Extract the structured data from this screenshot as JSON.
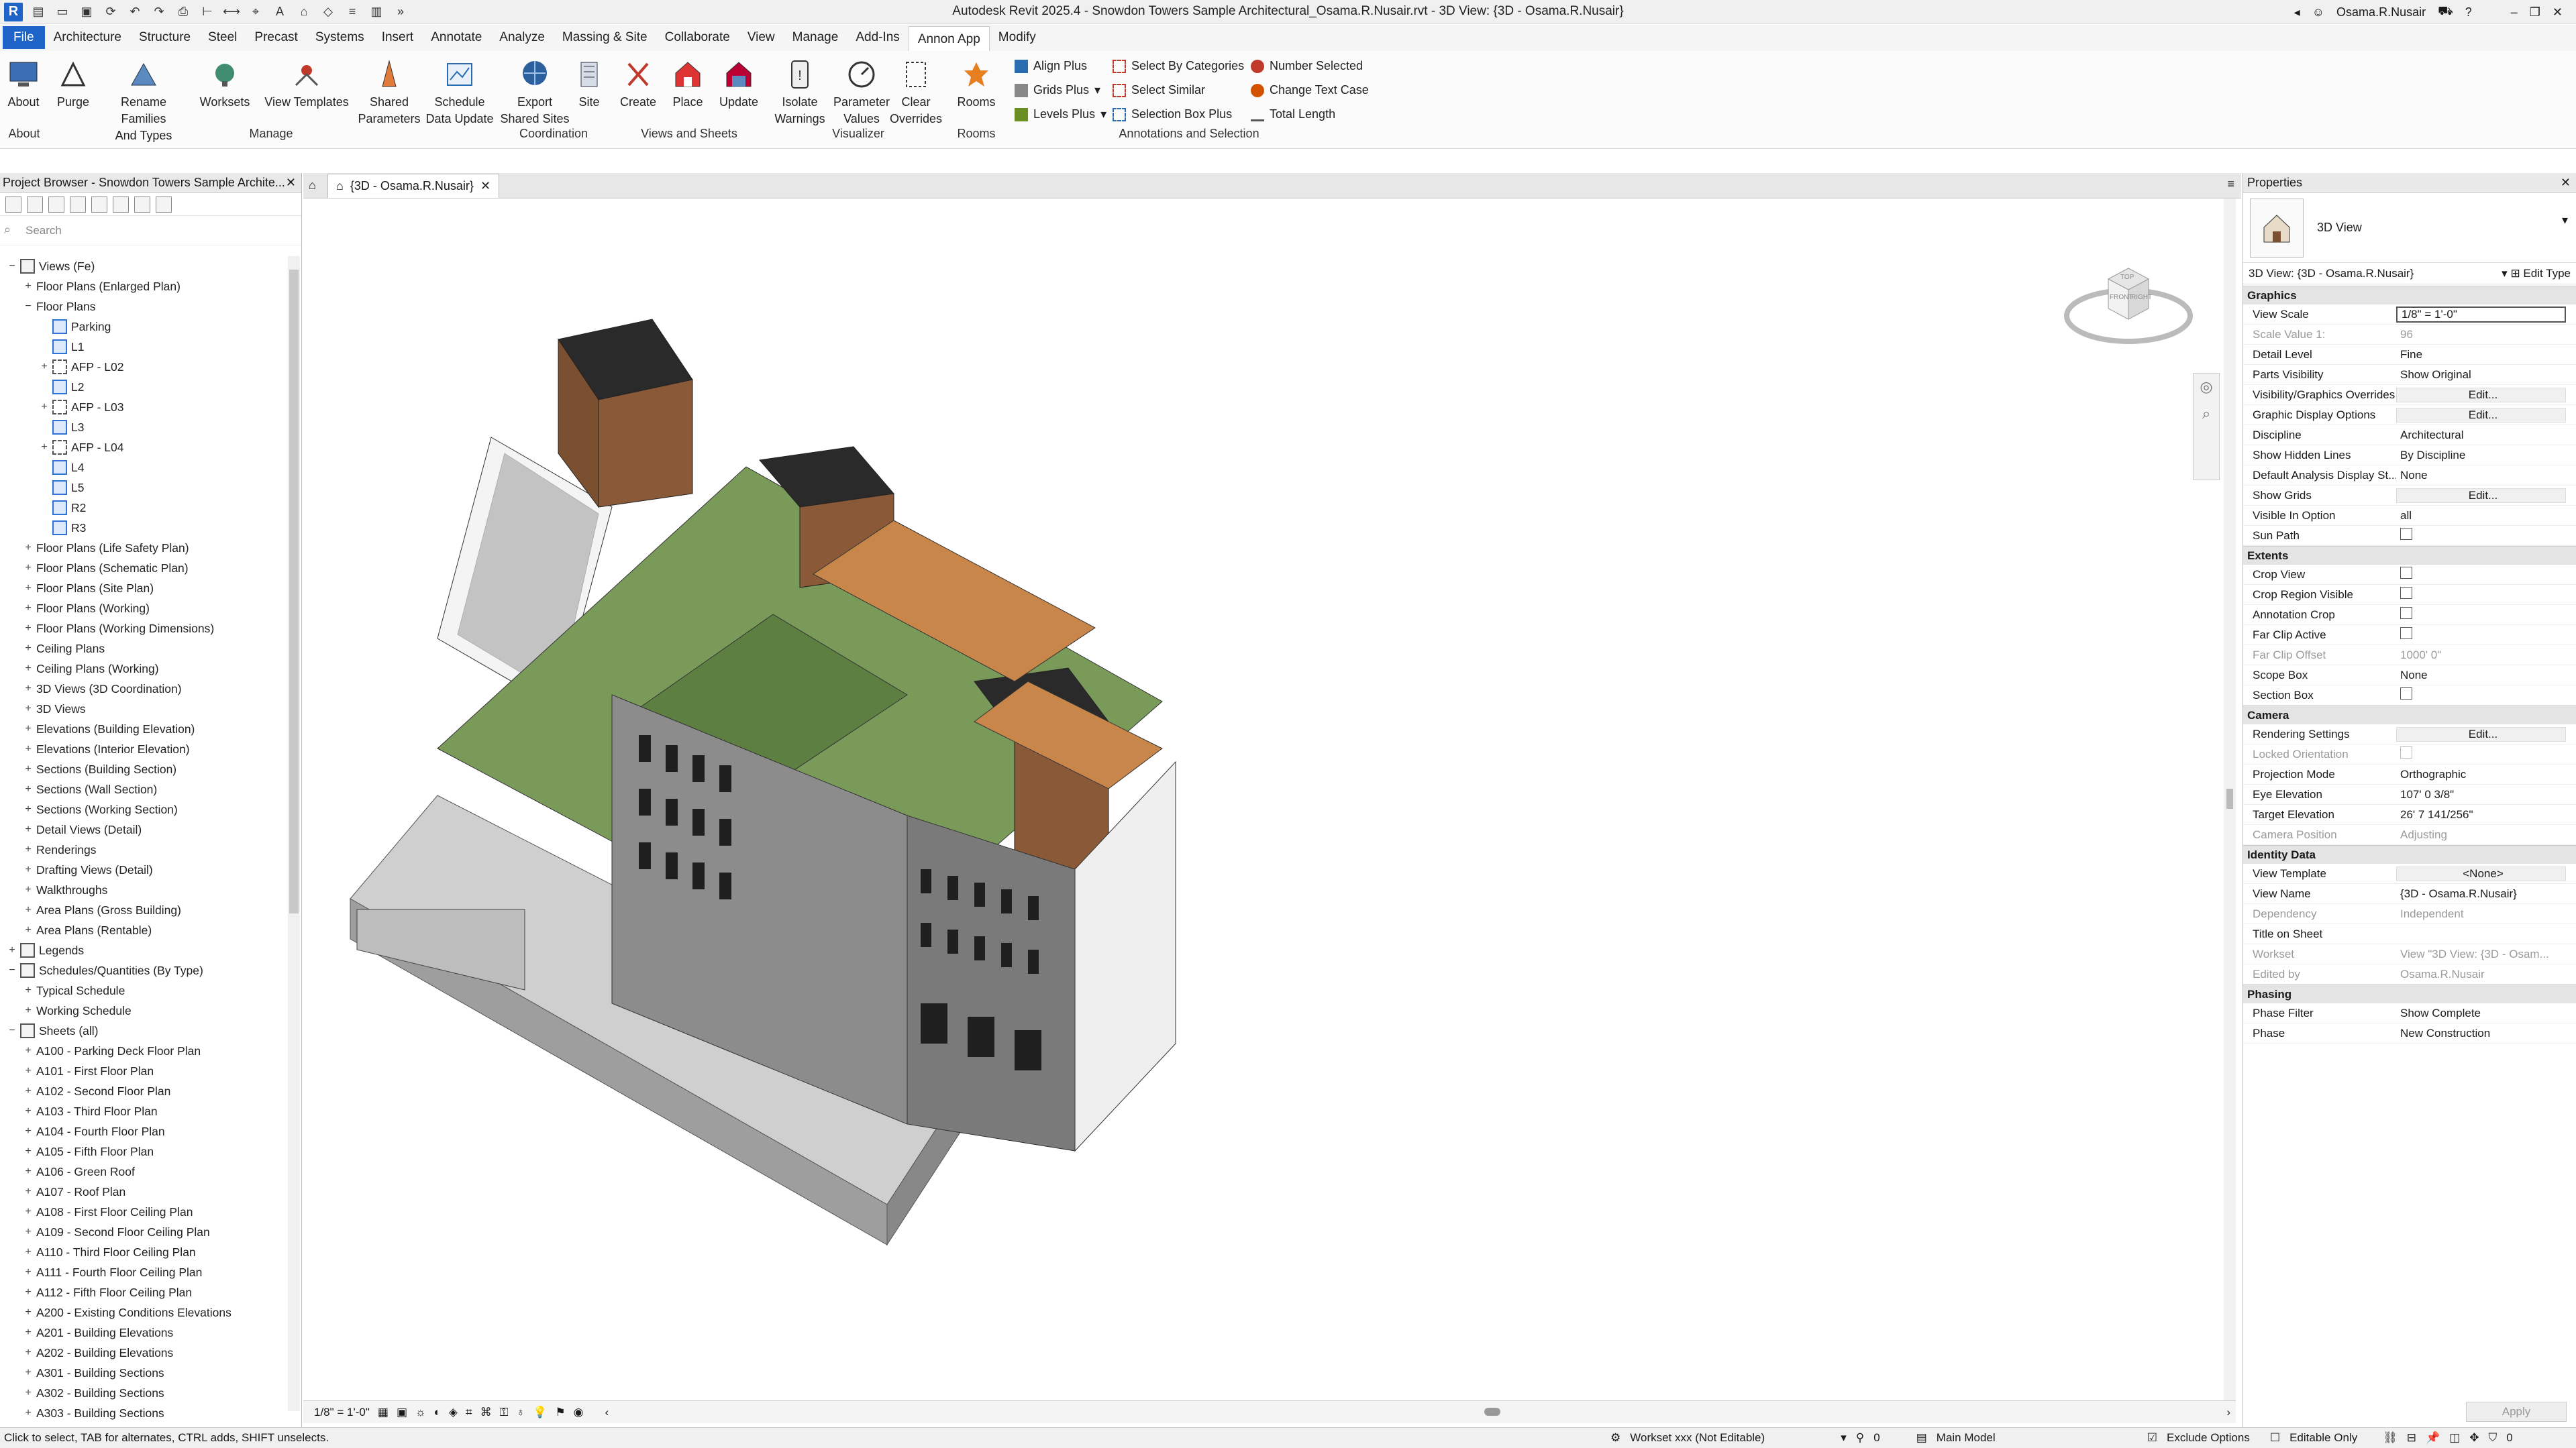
{
  "title": "Autodesk Revit 2025.4 - Snowdon Towers Sample Architectural_Osama.R.Nusair.rvt - 3D View: {3D - Osama.R.Nusair}",
  "user": "Osama.R.Nusair",
  "tabs": [
    "File",
    "Architecture",
    "Structure",
    "Steel",
    "Precast",
    "Systems",
    "Insert",
    "Annotate",
    "Analyze",
    "Massing & Site",
    "Collaborate",
    "View",
    "Manage",
    "Add-Ins",
    "Annon App",
    "Modify"
  ],
  "ribbon": {
    "about": "About",
    "purge": "Purge",
    "rename1": "Rename Families",
    "rename2": "And Types",
    "worksets": "Worksets",
    "view_templates": "View Templates",
    "shared1": "Shared",
    "shared2": "Parameters",
    "schedule1": "Schedule",
    "schedule2": "Data Update",
    "export1": "Export",
    "export2": "Shared Sites",
    "site": "Site",
    "create": "Create",
    "place": "Place",
    "update": "Update",
    "isolate1": "Isolate",
    "isolate2": "Warnings",
    "param1": "Parameter",
    "param2": "Values",
    "clear1": "Clear",
    "clear2": "Overrides",
    "rooms": "Rooms",
    "align_plus": "Align Plus",
    "grids_plus": "Grids Plus",
    "levels_plus": "Levels Plus",
    "select_cat": "Select By Categories",
    "select_sim": "Select Similar",
    "select_box": "Selection Box Plus",
    "number_sel": "Number Selected",
    "change_case": "Change Text Case",
    "total_len": "Total Length",
    "groups": {
      "about": "About",
      "manage": "Manage",
      "coordination": "Coordination",
      "views_sheets": "Views and Sheets",
      "visualizer": "Visualizer",
      "rooms": "Rooms",
      "annotations": "Annotations and Selection"
    }
  },
  "project_browser": {
    "title": "Project Browser - Snowdon Towers Sample Archite...",
    "search_placeholder": "Search",
    "tree": [
      {
        "label": "Views (Fe)",
        "lvl": 0,
        "t": "-",
        "icon": "views"
      },
      {
        "label": "Floor Plans (Enlarged Plan)",
        "lvl": 1,
        "t": "+"
      },
      {
        "label": "Floor Plans",
        "lvl": 1,
        "t": "-"
      },
      {
        "label": "Parking",
        "lvl": 2,
        "t": "",
        "icon": "view"
      },
      {
        "label": "L1",
        "lvl": 2,
        "t": "",
        "icon": "view"
      },
      {
        "label": "AFP - L02",
        "lvl": 2,
        "t": "+",
        "icon": "dash"
      },
      {
        "label": "L2",
        "lvl": 2,
        "t": "",
        "icon": "view"
      },
      {
        "label": "AFP - L03",
        "lvl": 2,
        "t": "+",
        "icon": "dash"
      },
      {
        "label": "L3",
        "lvl": 2,
        "t": "",
        "icon": "view"
      },
      {
        "label": "AFP - L04",
        "lvl": 2,
        "t": "+",
        "icon": "dash"
      },
      {
        "label": "L4",
        "lvl": 2,
        "t": "",
        "icon": "view"
      },
      {
        "label": "L5",
        "lvl": 2,
        "t": "",
        "icon": "view"
      },
      {
        "label": "R2",
        "lvl": 2,
        "t": "",
        "icon": "view"
      },
      {
        "label": "R3",
        "lvl": 2,
        "t": "",
        "icon": "view"
      },
      {
        "label": "Floor Plans (Life Safety Plan)",
        "lvl": 1,
        "t": "+"
      },
      {
        "label": "Floor Plans (Schematic Plan)",
        "lvl": 1,
        "t": "+"
      },
      {
        "label": "Floor Plans (Site Plan)",
        "lvl": 1,
        "t": "+"
      },
      {
        "label": "Floor Plans (Working)",
        "lvl": 1,
        "t": "+"
      },
      {
        "label": "Floor Plans (Working Dimensions)",
        "lvl": 1,
        "t": "+"
      },
      {
        "label": "Ceiling Plans",
        "lvl": 1,
        "t": "+"
      },
      {
        "label": "Ceiling Plans (Working)",
        "lvl": 1,
        "t": "+"
      },
      {
        "label": "3D Views (3D Coordination)",
        "lvl": 1,
        "t": "+"
      },
      {
        "label": "3D Views",
        "lvl": 1,
        "t": "+"
      },
      {
        "label": "Elevations (Building Elevation)",
        "lvl": 1,
        "t": "+"
      },
      {
        "label": "Elevations (Interior Elevation)",
        "lvl": 1,
        "t": "+"
      },
      {
        "label": "Sections (Building Section)",
        "lvl": 1,
        "t": "+"
      },
      {
        "label": "Sections (Wall Section)",
        "lvl": 1,
        "t": "+"
      },
      {
        "label": "Sections (Working Section)",
        "lvl": 1,
        "t": "+"
      },
      {
        "label": "Detail Views (Detail)",
        "lvl": 1,
        "t": "+"
      },
      {
        "label": "Renderings",
        "lvl": 1,
        "t": "+"
      },
      {
        "label": "Drafting Views (Detail)",
        "lvl": 1,
        "t": "+"
      },
      {
        "label": "Walkthroughs",
        "lvl": 1,
        "t": "+"
      },
      {
        "label": "Area Plans (Gross Building)",
        "lvl": 1,
        "t": "+"
      },
      {
        "label": "Area Plans (Rentable)",
        "lvl": 1,
        "t": "+"
      },
      {
        "label": "Legends",
        "lvl": 0,
        "t": "+",
        "icon": "legend"
      },
      {
        "label": "Schedules/Quantities (By Type)",
        "lvl": 0,
        "t": "-",
        "icon": "schedule"
      },
      {
        "label": "Typical Schedule",
        "lvl": 1,
        "t": "+"
      },
      {
        "label": "Working Schedule",
        "lvl": 1,
        "t": "+"
      },
      {
        "label": "Sheets (all)",
        "lvl": 0,
        "t": "-",
        "icon": "sheets"
      },
      {
        "label": "A100 - Parking Deck Floor Plan",
        "lvl": 1,
        "t": "+"
      },
      {
        "label": "A101 - First Floor Plan",
        "lvl": 1,
        "t": "+"
      },
      {
        "label": "A102 - Second Floor Plan",
        "lvl": 1,
        "t": "+"
      },
      {
        "label": "A103 - Third Floor Plan",
        "lvl": 1,
        "t": "+"
      },
      {
        "label": "A104 - Fourth Floor Plan",
        "lvl": 1,
        "t": "+"
      },
      {
        "label": "A105 - Fifth Floor Plan",
        "lvl": 1,
        "t": "+"
      },
      {
        "label": "A106 - Green Roof",
        "lvl": 1,
        "t": "+"
      },
      {
        "label": "A107 - Roof Plan",
        "lvl": 1,
        "t": "+"
      },
      {
        "label": "A108 - First Floor Ceiling Plan",
        "lvl": 1,
        "t": "+"
      },
      {
        "label": "A109 - Second Floor Ceiling Plan",
        "lvl": 1,
        "t": "+"
      },
      {
        "label": "A110 - Third Floor Ceiling Plan",
        "lvl": 1,
        "t": "+"
      },
      {
        "label": "A111 - Fourth Floor Ceiling Plan",
        "lvl": 1,
        "t": "+"
      },
      {
        "label": "A112 - Fifth Floor Ceiling Plan",
        "lvl": 1,
        "t": "+"
      },
      {
        "label": "A200 - Existing Conditions Elevations",
        "lvl": 1,
        "t": "+"
      },
      {
        "label": "A201 - Building Elevations",
        "lvl": 1,
        "t": "+"
      },
      {
        "label": "A202 - Building Elevations",
        "lvl": 1,
        "t": "+"
      },
      {
        "label": "A301 - Building Sections",
        "lvl": 1,
        "t": "+"
      },
      {
        "label": "A302 - Building Sections",
        "lvl": 1,
        "t": "+"
      },
      {
        "label": "A303 - Building Sections",
        "lvl": 1,
        "t": "+"
      }
    ]
  },
  "view_tab": {
    "label": "{3D - Osama.R.Nusair}"
  },
  "view_bar": {
    "scale": "1/8\" = 1'-0\""
  },
  "viewcube": {
    "top": "TOP",
    "front": "FRONT",
    "right": "RIGHT"
  },
  "properties": {
    "title": "Properties",
    "type_name": "3D View",
    "selector": "3D View: {3D - Osama.R.Nusair}",
    "edit_type": "Edit Type",
    "apply": "Apply",
    "sections": [
      {
        "name": "Graphics",
        "rows": [
          {
            "k": "View Scale",
            "v": "1/8\" = 1'-0\"",
            "s": "box"
          },
          {
            "k": "Scale Value    1:",
            "v": "96",
            "s": "dis"
          },
          {
            "k": "Detail Level",
            "v": "Fine"
          },
          {
            "k": "Parts Visibility",
            "v": "Show Original"
          },
          {
            "k": "Visibility/Graphics Overrides",
            "v": "Edit...",
            "s": "btn"
          },
          {
            "k": "Graphic Display Options",
            "v": "Edit...",
            "s": "btn"
          },
          {
            "k": "Discipline",
            "v": "Architectural"
          },
          {
            "k": "Show Hidden Lines",
            "v": "By Discipline"
          },
          {
            "k": "Default Analysis Display St...",
            "v": "None"
          },
          {
            "k": "Show Grids",
            "v": "Edit...",
            "s": "btn"
          },
          {
            "k": "Visible In Option",
            "v": "all"
          },
          {
            "k": "Sun Path",
            "v": "",
            "s": "cb"
          }
        ]
      },
      {
        "name": "Extents",
        "rows": [
          {
            "k": "Crop View",
            "v": "",
            "s": "cb"
          },
          {
            "k": "Crop Region Visible",
            "v": "",
            "s": "cb"
          },
          {
            "k": "Annotation Crop",
            "v": "",
            "s": "cb"
          },
          {
            "k": "Far Clip Active",
            "v": "",
            "s": "cb"
          },
          {
            "k": "Far Clip Offset",
            "v": "1000'  0\"",
            "s": "dis"
          },
          {
            "k": "Scope Box",
            "v": "None"
          },
          {
            "k": "Section Box",
            "v": "",
            "s": "cb"
          }
        ]
      },
      {
        "name": "Camera",
        "rows": [
          {
            "k": "Rendering Settings",
            "v": "Edit...",
            "s": "btn"
          },
          {
            "k": "Locked Orientation",
            "v": "",
            "s": "discb"
          },
          {
            "k": "Projection Mode",
            "v": "Orthographic"
          },
          {
            "k": "Eye Elevation",
            "v": "107'  0 3/8\""
          },
          {
            "k": "Target Elevation",
            "v": "26'  7 141/256\""
          },
          {
            "k": "Camera Position",
            "v": "Adjusting",
            "s": "dis"
          }
        ]
      },
      {
        "name": "Identity Data",
        "rows": [
          {
            "k": "View Template",
            "v": "<None>",
            "s": "btn"
          },
          {
            "k": "View Name",
            "v": "{3D - Osama.R.Nusair}"
          },
          {
            "k": "Dependency",
            "v": "Independent",
            "s": "dis"
          },
          {
            "k": "Title on Sheet",
            "v": ""
          },
          {
            "k": "Workset",
            "v": "View \"3D View: {3D - Osam...",
            "s": "dis"
          },
          {
            "k": "Edited by",
            "v": "Osama.R.Nusair",
            "s": "dis"
          }
        ]
      },
      {
        "name": "Phasing",
        "rows": [
          {
            "k": "Phase Filter",
            "v": "Show Complete"
          },
          {
            "k": "Phase",
            "v": "New Construction"
          }
        ]
      }
    ]
  },
  "status": {
    "hint": "Click to select, TAB for alternates, CTRL adds, SHIFT unselects.",
    "workset": "Workset xxx (Not Editable)",
    "count": "0",
    "model": "Main Model",
    "exclude": "Exclude Options",
    "editable": "Editable Only",
    "filter_count": "0"
  }
}
